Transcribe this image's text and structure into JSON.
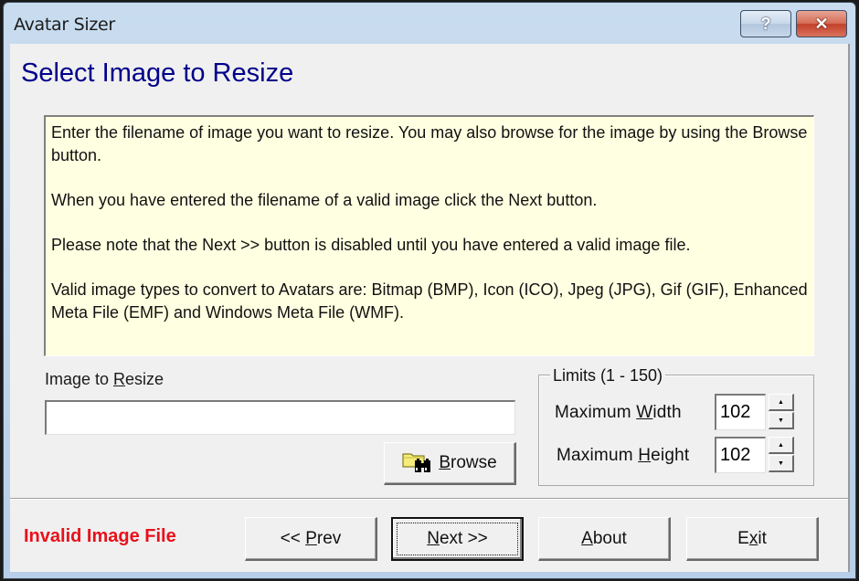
{
  "window": {
    "title": "Avatar Sizer",
    "help_button": "?",
    "close_button": "✕"
  },
  "page": {
    "title": "Select Image to Resize"
  },
  "info": {
    "paragraphs": [
      "Enter the filename of image you want to resize. You may also browse for the image by using the Browse button.",
      "When you have entered the filename of a valid image click the Next button.",
      "Please note that the Next >> button is disabled until you have entered a valid image file.",
      "Valid image types to convert to Avatars are: Bitmap (BMP), Icon (ICO),  Jpeg (JPG),  Gif (GIF), Enhanced Meta File (EMF) and Windows Meta File (WMF)."
    ]
  },
  "file": {
    "label_prefix": "Image to ",
    "label_accel": "R",
    "label_suffix": "esize",
    "value": "",
    "placeholder": ""
  },
  "browse": {
    "icon": "folder-binoculars-icon",
    "label_accel": "B",
    "label_suffix": "rowse"
  },
  "limits": {
    "legend": "Limits (1 - 150)",
    "width": {
      "label_prefix": "Maximum ",
      "label_accel": "W",
      "label_suffix": "idth",
      "value": "102"
    },
    "height": {
      "label_prefix": "Maximum ",
      "label_accel": "H",
      "label_suffix": "eight",
      "value": "102"
    },
    "up_glyph": "▲",
    "down_glyph": "▼"
  },
  "status": {
    "text": "Invalid Image File",
    "color": "#e8111a"
  },
  "buttons": {
    "prev": {
      "prefix": "<< ",
      "accel": "P",
      "suffix": "rev"
    },
    "next": {
      "prefix": "",
      "accel": "N",
      "suffix": "ext >>"
    },
    "about": {
      "prefix": "",
      "accel": "A",
      "suffix": "bout"
    },
    "exit": {
      "prefix": "E",
      "accel": "x",
      "suffix": "it"
    }
  }
}
